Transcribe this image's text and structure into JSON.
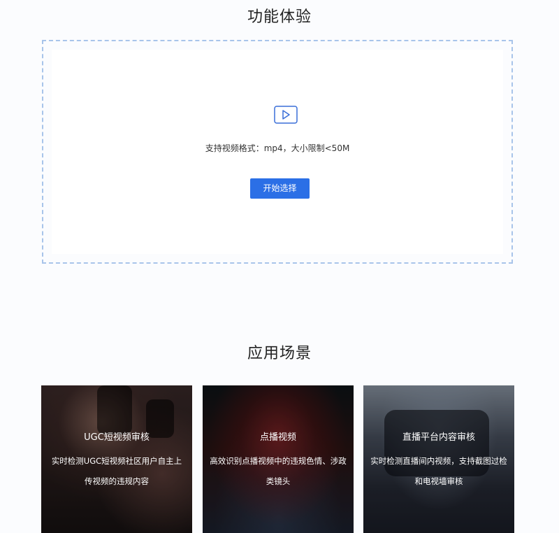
{
  "feature_section": {
    "title": "功能体验",
    "upload": {
      "icon": "video-play-icon",
      "hint": "支持视频格式：mp4，大小限制<50M",
      "button_label": "开始选择"
    }
  },
  "scenes_section": {
    "title": "应用场景",
    "cards": [
      {
        "title": "UGC短视频审核",
        "description": "实时检测UGC短视频社区用户自主上传视频的违规内容"
      },
      {
        "title": "点播视频",
        "description": "高效识别点播视频中的违规色情、涉政类镜头"
      },
      {
        "title": "直播平台内容审核",
        "description": "实时检测直播间内视频，支持截图过检和电视墙审核"
      }
    ]
  },
  "colors": {
    "accent": "#2b6fe6",
    "dashed_border": "#a8c4ea",
    "icon": "#3a6fd8"
  }
}
